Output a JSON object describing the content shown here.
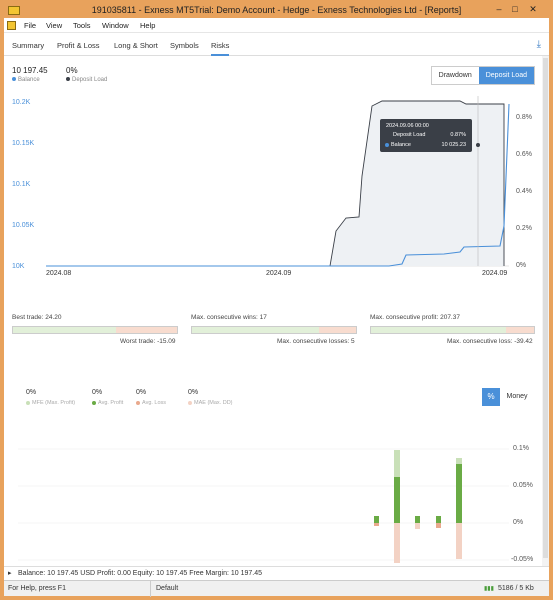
{
  "window": {
    "title": "191035811 - Exness MT5Trial: Demo Account - Hedge - Exness Technologies Ltd - [Reports]",
    "minimize": "–",
    "maximize": "□",
    "close": "✕"
  },
  "menu": {
    "items": [
      "File",
      "View",
      "Tools",
      "Window",
      "Help"
    ]
  },
  "tabs": [
    "Summary",
    "Profit & Loss",
    "Long & Short",
    "Symbols",
    "Risks"
  ],
  "active_tab": "Risks",
  "header": {
    "balance_value": "10 197.45",
    "balance_label": "Balance",
    "deposit_value": "0%",
    "deposit_label": "Deposit Load"
  },
  "toggle": {
    "drawdown": "Drawdown",
    "deposit_load": "Deposit Load"
  },
  "chart_data": {
    "type": "area",
    "y_left_ticks": [
      "10.2K",
      "10.15K",
      "10.1K",
      "10.05K",
      "10K"
    ],
    "y_right_ticks": [
      "0.8%",
      "0.6%",
      "0.4%",
      "0.2%",
      "0%"
    ],
    "x_ticks": [
      "2024.08",
      "2024.09",
      "2024.09"
    ],
    "tooltip": {
      "date": "2024.09.06 00:00",
      "deposit_label": "Deposit Load",
      "deposit_value": "0.87%",
      "balance_label": "Balance",
      "balance_value": "10 025.23"
    },
    "colors": {
      "balance": "#4a90d9",
      "deposit": "#3a3f47"
    }
  },
  "stats": {
    "best_trade": "Best trade: 24.20",
    "worst_trade": "Worst trade: -15.09",
    "max_wins": "Max. consecutive wins: 17",
    "max_losses": "Max. consecutive losses: 5",
    "max_profit": "Max. consecutive profit: 207.37",
    "max_loss": "Max. consecutive loss: -39.42"
  },
  "mfe": {
    "items": [
      {
        "value": "0%",
        "label": "MFE (Max. Profit)",
        "color": "#c9e0b8"
      },
      {
        "value": "0%",
        "label": "Avg. Profit",
        "color": "#6aab45"
      },
      {
        "value": "0%",
        "label": "Avg. Loss",
        "color": "#e9a98d"
      },
      {
        "value": "0%",
        "label": "MAE (Max. DD)",
        "color": "#f3d2c4"
      }
    ],
    "percent_btn": "%",
    "money_btn": "Money",
    "y_ticks": [
      "0.1%",
      "0.05%",
      "0%",
      "-0.05%"
    ]
  },
  "statusline": "Balance: 10 197.45 USD  Profit: 0.00  Equity: 10 197.45  Free Margin: 10 197.45",
  "statusbar": {
    "help": "For Help, press F1",
    "profile": "Default",
    "traffic": "5186 / 5 Kb"
  }
}
